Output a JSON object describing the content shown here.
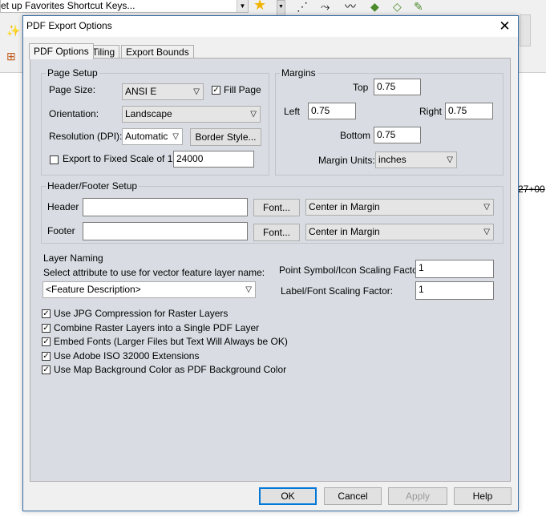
{
  "background": {
    "shortcut_combo_text": "et up Favorites Shortcut Keys...",
    "scale_text": "27+00"
  },
  "dialog": {
    "title": "PDF Export Options",
    "tabs": [
      "PDF Options",
      "Tiling",
      "Export Bounds"
    ],
    "page_setup": {
      "group_label": "Page Setup",
      "page_size_label": "Page Size:",
      "page_size_value": "ANSI E",
      "fill_page_label": "Fill Page",
      "fill_page_checked": true,
      "orientation_label": "Orientation:",
      "orientation_value": "Landscape",
      "resolution_label": "Resolution (DPI):",
      "resolution_value": "Automatic",
      "border_style_label": "Border Style...",
      "fixed_scale_label": "Export to Fixed Scale of 1:",
      "fixed_scale_checked": false,
      "fixed_scale_value": "24000"
    },
    "margins": {
      "group_label": "Margins",
      "top_label": "Top",
      "top_value": "0.75",
      "left_label": "Left",
      "left_value": "0.75",
      "right_label": "Right",
      "right_value": "0.75",
      "bottom_label": "Bottom",
      "bottom_value": "0.75",
      "units_label": "Margin Units:",
      "units_value": "inches"
    },
    "header_footer": {
      "group_label": "Header/Footer Setup",
      "header_label": "Header",
      "header_value": "",
      "footer_label": "Footer",
      "footer_value": "",
      "font_button": "Font...",
      "header_align": "Center in Margin",
      "footer_align": "Center in Margin"
    },
    "layer_naming": {
      "group_label": "Layer Naming",
      "prompt": "Select attribute to use for vector feature layer name:",
      "value": "<Feature Description>"
    },
    "scaling": {
      "point_label": "Point Symbol/Icon Scaling Factor:",
      "point_value": "1",
      "label_label": "Label/Font Scaling Factor:",
      "label_value": "1"
    },
    "options": [
      {
        "label": "Use JPG Compression for Raster Layers",
        "checked": true
      },
      {
        "label": "Combine Raster Layers into a Single PDF Layer",
        "checked": true
      },
      {
        "label": "Embed Fonts (Larger Files but Text Will Always be OK)",
        "checked": true
      },
      {
        "label": "Use Adobe ISO 32000 Extensions",
        "checked": true
      },
      {
        "label": "Use Map Background Color as PDF Background Color",
        "checked": true
      }
    ],
    "buttons": {
      "ok": "OK",
      "cancel": "Cancel",
      "apply": "Apply",
      "help": "Help"
    },
    "colors": {
      "accent": "#0078d7",
      "panel": "#d9dde3"
    }
  }
}
